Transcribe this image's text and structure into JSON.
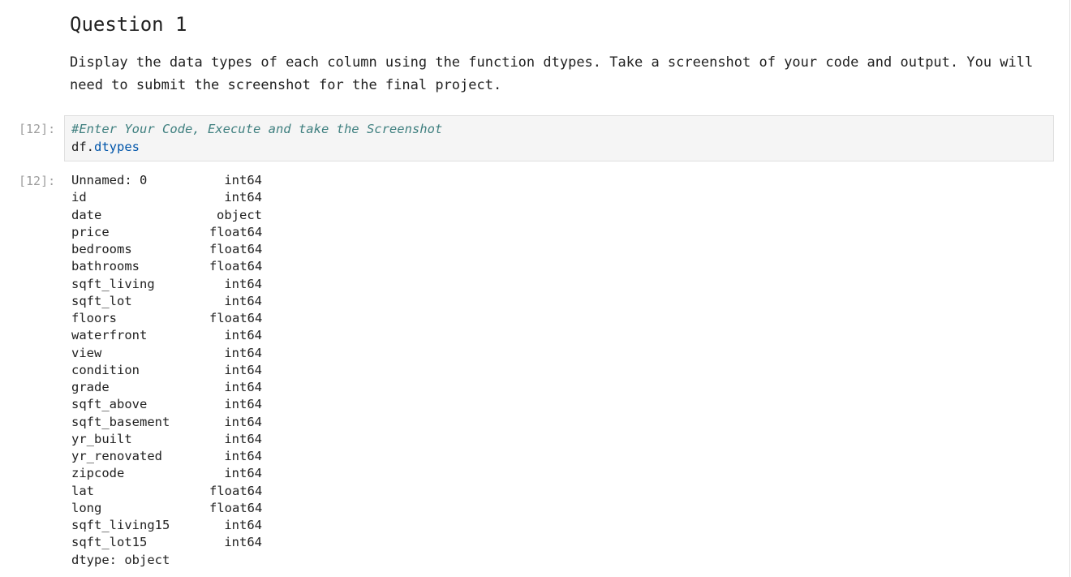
{
  "markdown": {
    "heading": "Question 1",
    "paragraph": "Display the data types of each column using the function dtypes. Take a screenshot of your code and output. You will need to submit the screenshot for the final project."
  },
  "input_cell": {
    "prompt": "[12]:",
    "comment": "#Enter Your Code, Execute and take the Screenshot",
    "code_object": "df",
    "code_dot": ".",
    "code_attribute": "dtypes"
  },
  "output_cell": {
    "prompt": "[12]:",
    "rows": [
      {
        "name": "Unnamed: 0",
        "dtype": "int64"
      },
      {
        "name": "id",
        "dtype": "int64"
      },
      {
        "name": "date",
        "dtype": "object"
      },
      {
        "name": "price",
        "dtype": "float64"
      },
      {
        "name": "bedrooms",
        "dtype": "float64"
      },
      {
        "name": "bathrooms",
        "dtype": "float64"
      },
      {
        "name": "sqft_living",
        "dtype": "int64"
      },
      {
        "name": "sqft_lot",
        "dtype": "int64"
      },
      {
        "name": "floors",
        "dtype": "float64"
      },
      {
        "name": "waterfront",
        "dtype": "int64"
      },
      {
        "name": "view",
        "dtype": "int64"
      },
      {
        "name": "condition",
        "dtype": "int64"
      },
      {
        "name": "grade",
        "dtype": "int64"
      },
      {
        "name": "sqft_above",
        "dtype": "int64"
      },
      {
        "name": "sqft_basement",
        "dtype": "int64"
      },
      {
        "name": "yr_built",
        "dtype": "int64"
      },
      {
        "name": "yr_renovated",
        "dtype": "int64"
      },
      {
        "name": "zipcode",
        "dtype": "int64"
      },
      {
        "name": "lat",
        "dtype": "float64"
      },
      {
        "name": "long",
        "dtype": "float64"
      },
      {
        "name": "sqft_living15",
        "dtype": "int64"
      },
      {
        "name": "sqft_lot15",
        "dtype": "int64"
      }
    ],
    "footer": "dtype: object"
  },
  "colors": {
    "comment": "#408080",
    "attribute": "#0055aa",
    "prompt": "#9e9e9e",
    "code_background": "#f5f5f5"
  }
}
